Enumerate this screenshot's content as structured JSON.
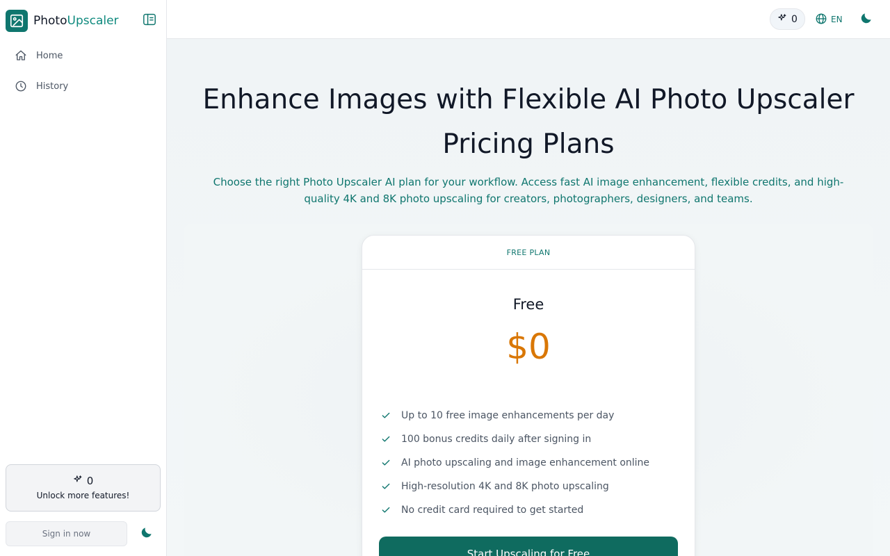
{
  "brand": {
    "name_part1": "Photo",
    "name_part2": "Upscaler",
    "logo_icon": "image-upscale-icon"
  },
  "sidebar": {
    "collapse_icon": "sidebar-collapse-icon",
    "items": [
      {
        "label": "Home",
        "icon": "home-icon"
      },
      {
        "label": "History",
        "icon": "clock-icon"
      }
    ],
    "credits": {
      "count": "0",
      "message": "Unlock more features!",
      "icon": "sparkles-icon"
    },
    "signin_label": "Sign in now",
    "theme_icon": "moon-icon"
  },
  "header": {
    "credits_count": "0",
    "language": "EN",
    "icons": {
      "credits": "sparkles-icon",
      "language": "globe-icon",
      "theme": "moon-icon"
    }
  },
  "hero": {
    "title": "Enhance Images with Flexible AI Photo Upscaler Pricing Plans",
    "subtitle": "Choose the right Photo Upscaler AI plan for your workflow. Access fast AI image enhancement, flexible credits, and high-quality 4K and 8K photo upscaling for creators, photographers, designers, and teams."
  },
  "plan": {
    "badge": "FREE PLAN",
    "name": "Free",
    "price": "$0",
    "features": [
      "Up to 10 free image enhancements per day",
      "100 bonus credits daily after signing in",
      "AI photo upscaling and image enhancement online",
      "High-resolution 4K and 8K photo upscaling",
      "No credit card required to get started"
    ],
    "cta_label": "Start Upscaling for Free"
  },
  "colors": {
    "brand": "#0f766e",
    "accent_price": "#d97706",
    "cta_bg": "#0f6b5f"
  }
}
